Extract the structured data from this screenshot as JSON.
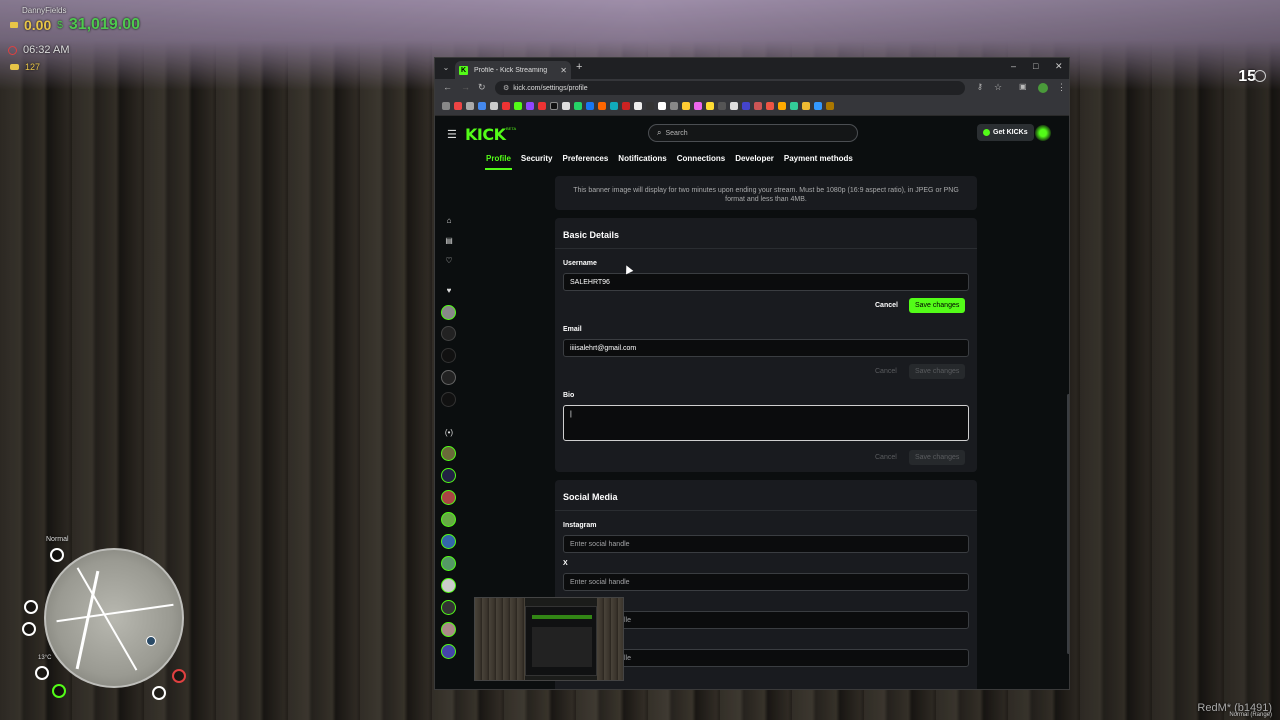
{
  "hud": {
    "player_name": "DannyFields",
    "gold": "0.00",
    "cash": "31,019.00",
    "time": "06:32 AM",
    "level": "127",
    "ammo": "15",
    "minimap_mode": "Normal",
    "temperature": "13°C",
    "watermark": "RedM* (b1491)",
    "watermark_sub": "Normal (Range)"
  },
  "browser": {
    "tab_title": "Profile - Kick Streaming",
    "tab_favicon": "K",
    "new_tab": "+",
    "url": "kick.com/settings/profile",
    "window_controls": [
      "–",
      "□",
      "✕"
    ]
  },
  "kick": {
    "logo": "KICK",
    "beta": "BETA",
    "search_placeholder": "Search",
    "get_kicks_label": "Get KICKs",
    "tabs": [
      {
        "label": "Profile",
        "active": true
      },
      {
        "label": "Security"
      },
      {
        "label": "Preferences"
      },
      {
        "label": "Notifications"
      },
      {
        "label": "Connections"
      },
      {
        "label": "Developer"
      },
      {
        "label": "Payment methods"
      }
    ],
    "accent_color": "#53fc18"
  },
  "settings": {
    "banner_note": "This banner image will display for two minutes upon ending your stream. Must be 1080p (16:9 aspect ratio), in JPEG or PNG format and less than 4MB.",
    "basic_details": {
      "title": "Basic Details",
      "username_label": "Username",
      "username_value": "SALEHRT96",
      "email_label": "Email",
      "email_value": "iiiisalehrt@gmail.com",
      "bio_label": "Bio",
      "bio_value": "|",
      "cancel_label": "Cancel",
      "save_label": "Save changes"
    },
    "social_media": {
      "title": "Social Media",
      "instagram_label": "Instagram",
      "x_label": "X",
      "placeholder": "Enter social handle",
      "partial_placeholder": "lle"
    }
  }
}
